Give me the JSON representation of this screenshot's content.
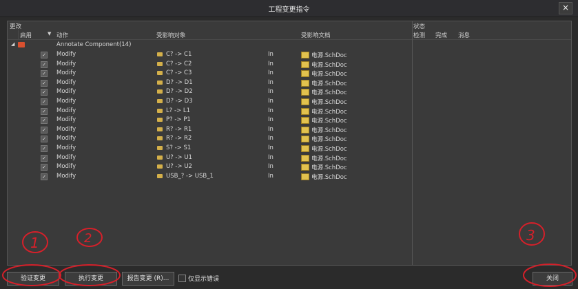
{
  "window": {
    "title": "工程变更指令",
    "close": "×"
  },
  "headers": {
    "group_changes": "更改",
    "group_status": "状态",
    "enable": "启用",
    "action": "动作",
    "affected_object": "受影响对象",
    "affected_doc": "受影响文档",
    "check": "检测",
    "done": "完成",
    "message": "消息"
  },
  "group": {
    "label": "Annotate Component(14)"
  },
  "rows": [
    {
      "action": "Modify",
      "object": "C? -> C1",
      "dir": "In",
      "doc": "电源.SchDoc"
    },
    {
      "action": "Modify",
      "object": "C? -> C2",
      "dir": "In",
      "doc": "电源.SchDoc"
    },
    {
      "action": "Modify",
      "object": "C? -> C3",
      "dir": "In",
      "doc": "电源.SchDoc"
    },
    {
      "action": "Modify",
      "object": "D? -> D1",
      "dir": "In",
      "doc": "电源.SchDoc"
    },
    {
      "action": "Modify",
      "object": "D? -> D2",
      "dir": "In",
      "doc": "电源.SchDoc"
    },
    {
      "action": "Modify",
      "object": "D? -> D3",
      "dir": "In",
      "doc": "电源.SchDoc"
    },
    {
      "action": "Modify",
      "object": "L? -> L1",
      "dir": "In",
      "doc": "电源.SchDoc"
    },
    {
      "action": "Modify",
      "object": "P? -> P1",
      "dir": "In",
      "doc": "电源.SchDoc"
    },
    {
      "action": "Modify",
      "object": "R? -> R1",
      "dir": "In",
      "doc": "电源.SchDoc"
    },
    {
      "action": "Modify",
      "object": "R? -> R2",
      "dir": "In",
      "doc": "电源.SchDoc"
    },
    {
      "action": "Modify",
      "object": "S? -> S1",
      "dir": "In",
      "doc": "电源.SchDoc"
    },
    {
      "action": "Modify",
      "object": "U? -> U1",
      "dir": "In",
      "doc": "电源.SchDoc"
    },
    {
      "action": "Modify",
      "object": "U? -> U2",
      "dir": "In",
      "doc": "电源.SchDoc"
    },
    {
      "action": "Modify",
      "object": "USB_? -> USB_1",
      "dir": "In",
      "doc": "电源.SchDoc"
    }
  ],
  "buttons": {
    "validate": "验证变更",
    "execute": "执行变更",
    "report": "报告变更 (R)...",
    "only_errors": "仅显示错误",
    "close": "关闭"
  },
  "annotations": {
    "one": "1",
    "two": "2",
    "three": "3"
  }
}
